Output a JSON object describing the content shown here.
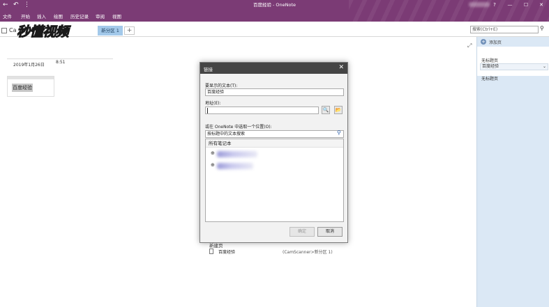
{
  "window": {
    "title": "百度经验 - OneNote",
    "back_glyph": "←",
    "undo_glyph": "↶",
    "more_glyph": "⋮",
    "help_glyph": "?",
    "restore_glyph": "▭",
    "minimize_glyph": "—",
    "maximize_glyph": "☐"
  },
  "ribbon": {
    "tabs": [
      "文件",
      "开始",
      "插入",
      "绘图",
      "历史记录",
      "审阅",
      "视图"
    ]
  },
  "section_bar": {
    "notebook_name": "Ca",
    "watermark": "秒懂视频",
    "active_section": "新分区 1",
    "add_section_glyph": "+",
    "search_placeholder": "搜索(Ctrl+E)",
    "search_glyph": "⚲"
  },
  "page": {
    "date": "2019年1月26日",
    "time": "8:51",
    "note_text": "百度经验",
    "expand_glyph": "⤢"
  },
  "page_panel": {
    "add_page_icon": "+",
    "add_page_label": "添加页",
    "items": [
      "无标题页",
      "百度经验",
      "无标题页"
    ],
    "dropdown_glyph": "⌄"
  },
  "dialog": {
    "title": "链接",
    "close_glyph": "✕",
    "text_label": "要显示的文本(T):",
    "text_value": "百度经验",
    "address_label": "地址(E):",
    "address_value": "",
    "browse_web_glyph": "🔍",
    "browse_file_glyph": "📂",
    "location_label": "或在 OneNote 中选取一个位置(O):",
    "location_search_placeholder": "按标题中的文本搜索",
    "location_search_glyph": "⚲",
    "all_notebooks": "所有笔记本",
    "expand_glyph": "⊕",
    "new_pages_header": "新建页",
    "result": {
      "name": "百度经验",
      "path": "(CamScanner>新分区 1)"
    },
    "ok_label": "确定",
    "cancel_label": "取消"
  }
}
